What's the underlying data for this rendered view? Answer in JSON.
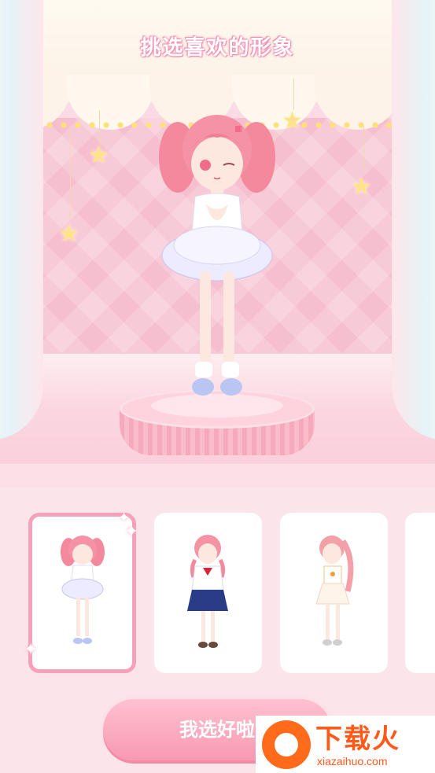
{
  "title": "挑选喜欢的形象",
  "confirm_label": "我选好啦",
  "watermark": {
    "brand": "下载火",
    "site": "xiazaihuo.com"
  },
  "characters": [
    {
      "name": "twin-tail-tutu",
      "selected": true
    },
    {
      "name": "sailor-uniform",
      "selected": false
    },
    {
      "name": "side-ponytail",
      "selected": false
    },
    {
      "name": "partial-card",
      "selected": false
    }
  ],
  "colors": {
    "accent": "#f799b1",
    "card": "#ffffff",
    "panel": "#fbe4ea"
  }
}
